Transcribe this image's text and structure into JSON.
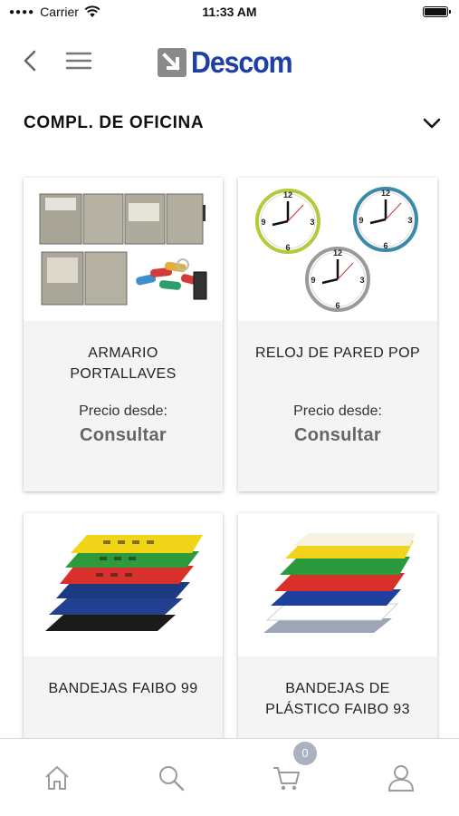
{
  "status_bar": {
    "carrier": "Carrier",
    "time": "11:33 AM"
  },
  "header": {
    "logo_text": "Descom",
    "brand_color": "#1d3fa6"
  },
  "category": {
    "title": "COMPL. DE OFICINA"
  },
  "products": [
    {
      "name": "ARMARIO PORTALLAVES",
      "price_label": "Precio desde:",
      "price": "Consultar",
      "image": "key-cabinets-image"
    },
    {
      "name": "RELOJ DE PARED POP",
      "price_label": "Precio desde:",
      "price": "Consultar",
      "image": "wall-clocks-image"
    },
    {
      "name": "BANDEJAS FAIBO 99",
      "image": "letter-trays-image"
    },
    {
      "name": "BANDEJAS DE PLÁSTICO FAIBO 93",
      "image": "plastic-trays-image"
    }
  ],
  "tab_bar": {
    "items": [
      "home-icon",
      "search-icon",
      "cart-icon",
      "user-icon"
    ],
    "cart_count": "0"
  }
}
